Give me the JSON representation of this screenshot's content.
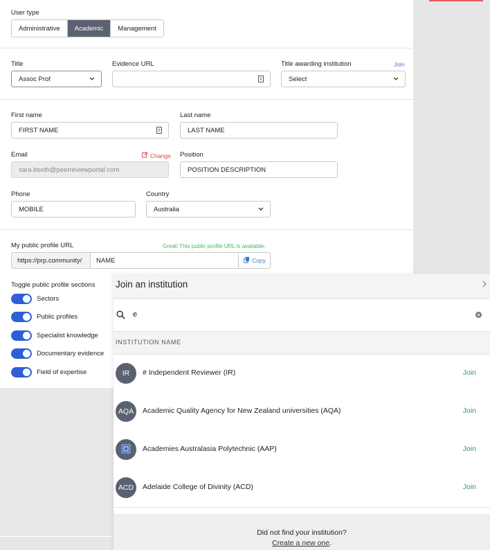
{
  "user_type": {
    "label": "User type",
    "options": [
      "Administrative",
      "Academic",
      "Management"
    ],
    "selected": "Academic"
  },
  "title_section": {
    "title_label": "Title",
    "title_value": "Assoc Prof",
    "evidence_label": "Evidence URL",
    "evidence_value": "",
    "institution_label": "Title awarding institution",
    "institution_join": "Join",
    "institution_value": "Select"
  },
  "personal": {
    "first_name_label": "First name",
    "first_name_value": "FIRST NAME",
    "last_name_label": "Last name",
    "last_name_value": "LAST NAME",
    "email_label": "Email",
    "email_change": "Change",
    "email_value": "sara.booth@peerreviewportal.com",
    "position_label": "Position",
    "position_value": "POSITION DESCRIPTION",
    "phone_label": "Phone",
    "phone_value": "MOBILE",
    "country_label": "Country",
    "country_value": "Australia"
  },
  "profile_url": {
    "label": "My public profile URL",
    "status": "Great! This public profile URL is available.",
    "prefix": "https://prp.community/",
    "value": "NAME",
    "copy_label": "Copy"
  },
  "toggles": {
    "label": "Toggle public profile sections",
    "items": [
      {
        "label": "Sectors",
        "on": true
      },
      {
        "label": "Public profiles",
        "on": true
      },
      {
        "label": "Specialist knowledge",
        "on": true
      },
      {
        "label": "Documentary evidence",
        "on": true
      },
      {
        "label": "Field of expertise",
        "on": true
      }
    ]
  },
  "modal": {
    "title": "Join an institution",
    "search_value": "e",
    "column_header": "INSTITUTION NAME",
    "rows": [
      {
        "avatar": "IR",
        "name": "# Independent Reviewer (IR)",
        "action": "Join"
      },
      {
        "avatar": "AQA",
        "name": "Academic Quality Agency for New Zealand universities (AQA)",
        "action": "Join"
      },
      {
        "avatar": "",
        "name": "Academies Australasia Polytechnic (AAP)",
        "action": "Join"
      },
      {
        "avatar": "ACD",
        "name": "Adelaide College of Divinity (ACD)",
        "action": "Join"
      }
    ],
    "footer_question": "Did not find your institution?",
    "footer_link": "Create a new one",
    "footer_period": "."
  },
  "colors": {
    "accent_blue": "#2f5fd6",
    "join_green": "#2f9e55",
    "selected_segment": "#5a6170",
    "change_red": "#d64545"
  }
}
